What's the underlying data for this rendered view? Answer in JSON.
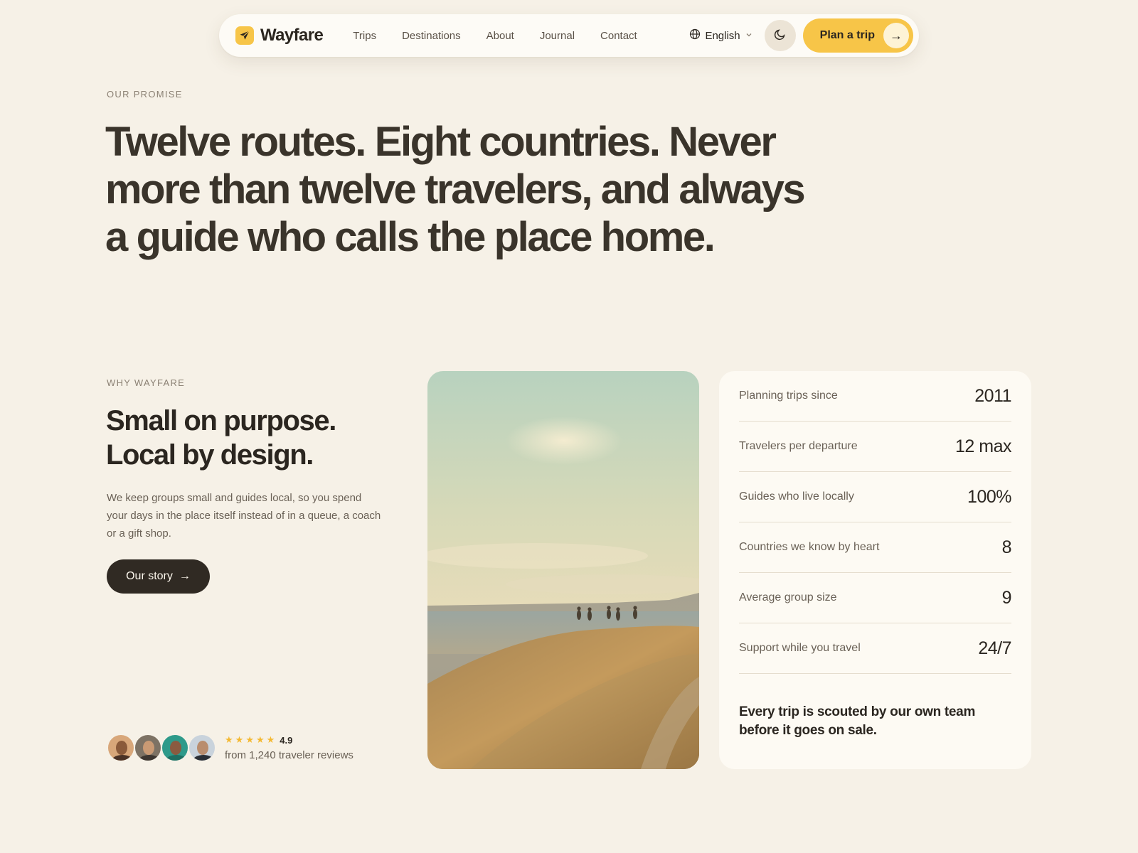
{
  "nav": {
    "brand": "Wayfare",
    "links": [
      "Trips",
      "Destinations",
      "About",
      "Journal",
      "Contact"
    ],
    "language": "English",
    "cta_label": "Plan a trip",
    "cta_arrow": "→"
  },
  "hero": {
    "eyebrow": "OUR PROMISE",
    "title": "Twelve routes. Eight countries. Never more than twelve travelers, and always a guide who calls the place home."
  },
  "why": {
    "eyebrow": "WHY WAYFARE",
    "title_line1": "Small on purpose.",
    "title_line2": "Local by design.",
    "body": "We keep groups small and guides local, so you spend your days in the place itself instead of in a queue, a coach or a gift shop.",
    "button_label": "Our story",
    "button_arrow": "→"
  },
  "reviews": {
    "stars": 5,
    "rating": "4.9",
    "count_text": "from 1,240 traveler reviews"
  },
  "stats": {
    "rows": [
      {
        "label": "Planning trips since",
        "value": "2011"
      },
      {
        "label": "Travelers per departure",
        "value": "12 max"
      },
      {
        "label": "Guides who live locally",
        "value": "100%"
      },
      {
        "label": "Countries we know by heart",
        "value": "8"
      },
      {
        "label": "Average group size",
        "value": "9"
      },
      {
        "label": "Support while you travel",
        "value": "24/7"
      }
    ],
    "note": "Every trip is scouted by our own team before it goes on sale."
  },
  "colors": {
    "background": "#f6f1e7",
    "accent": "#f7c548",
    "dark": "#302a23",
    "star": "#f4b932"
  },
  "icons": [
    "paper-plane-icon",
    "globe-icon",
    "chevron-down-icon",
    "moon-icon",
    "arrow-right-icon",
    "star-icon"
  ]
}
